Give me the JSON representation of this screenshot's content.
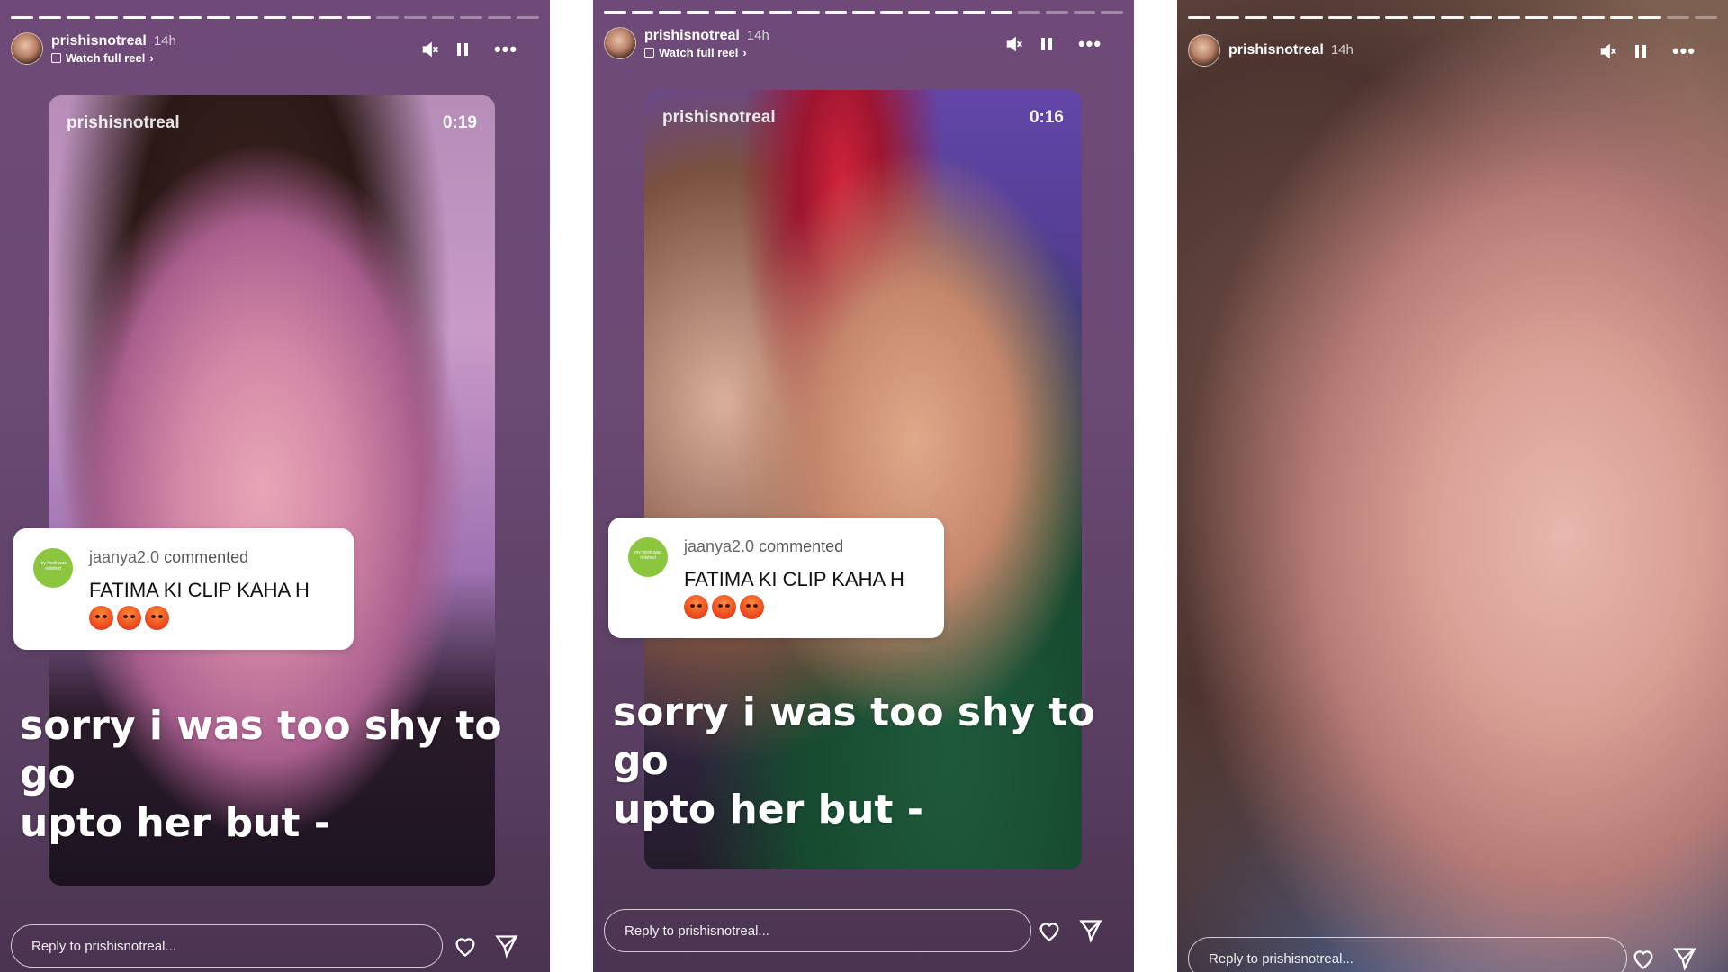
{
  "stories": [
    {
      "username": "prishisnotreal",
      "time": "14h",
      "watch_full_reel": "Watch full reel",
      "reel": {
        "username": "prishisnotreal",
        "timestamp": "0:19"
      },
      "comment": {
        "author": "jaanya2.0",
        "action": "commented",
        "text": "FATIMA KI CLIP KAHA H",
        "avatar_text": "my fresh was relished"
      },
      "caption_line1": "sorry i was too shy to go",
      "caption_line2": "upto her but  -",
      "reply_placeholder": "Reply to prishisnotreal...",
      "progress_total": 19,
      "progress_done": 13
    },
    {
      "username": "prishisnotreal",
      "time": "14h",
      "watch_full_reel": "Watch full reel",
      "reel": {
        "username": "prishisnotreal",
        "timestamp": "0:16"
      },
      "comment": {
        "author": "jaanya2.0",
        "action": "commented",
        "text": "FATIMA KI CLIP KAHA H",
        "avatar_text": "my fresh was relished"
      },
      "caption_line1": "sorry i was too shy to go",
      "caption_line2": "upto her but  -",
      "reply_placeholder": "Reply to prishisnotreal...",
      "progress_total": 19,
      "progress_done": 15
    },
    {
      "username": "prishisnotreal",
      "time": "14h",
      "reply_placeholder": "Reply to prishisnotreal...",
      "progress_total": 19,
      "progress_done": 17
    }
  ]
}
